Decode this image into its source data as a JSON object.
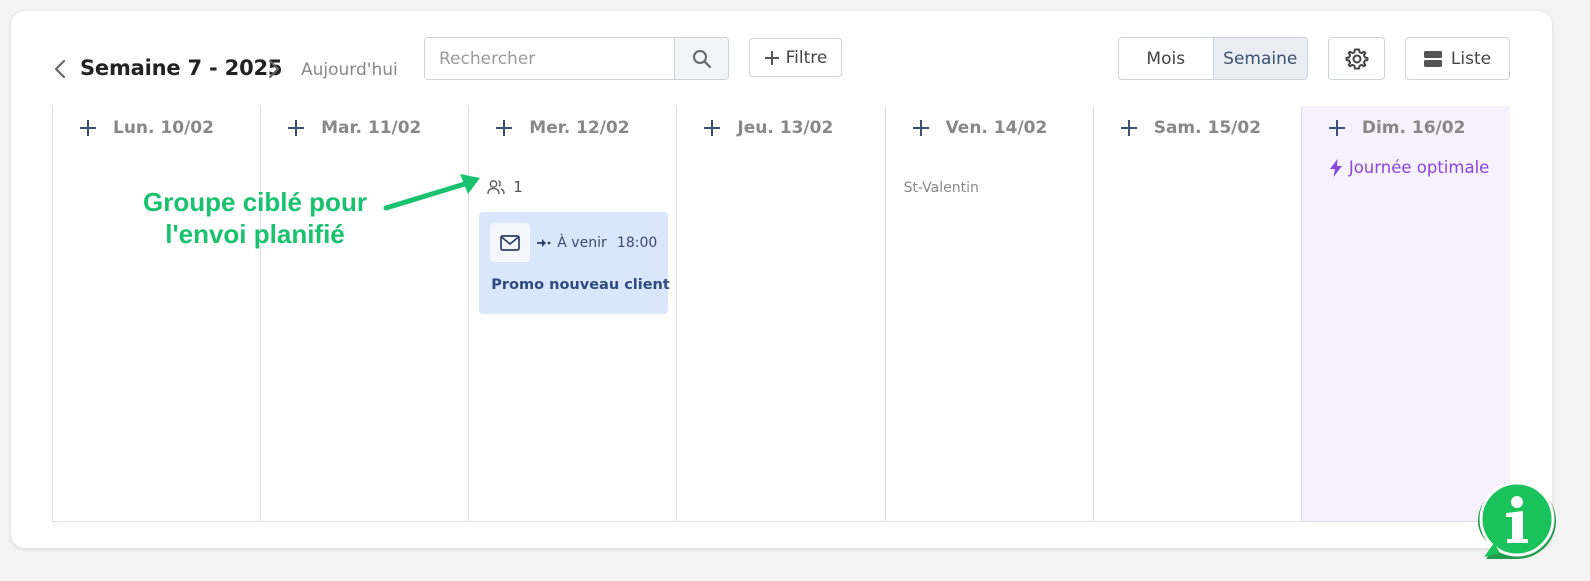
{
  "toolbar": {
    "week_title": "Semaine 7 - 2025",
    "today_label": "Aujourd'hui",
    "search_placeholder": "Rechercher",
    "filter_label": "Filtre",
    "view_month": "Mois",
    "view_week": "Semaine",
    "list_label": "Liste"
  },
  "days": [
    {
      "label": "Lun. 10/02"
    },
    {
      "label": "Mar. 11/02"
    },
    {
      "label": "Mer. 12/02"
    },
    {
      "label": "Jeu. 13/02"
    },
    {
      "label": "Ven. 14/02"
    },
    {
      "label": "Sam. 15/02"
    },
    {
      "label": "Dim. 16/02"
    }
  ],
  "wednesday": {
    "group_count": "1",
    "event": {
      "status": "À venir",
      "time": "18:00",
      "title": "Promo nouveau client"
    }
  },
  "friday": {
    "holiday": "St-Valentin"
  },
  "sunday": {
    "optimal_label": "Journée optimale"
  },
  "annotation": {
    "line1": "Groupe ciblé pour",
    "line2": "l'envoi planifié"
  },
  "colors": {
    "accent_purple": "#8a45e0",
    "event_bg": "#d8e7fb",
    "annotation_green": "#18c26e"
  }
}
